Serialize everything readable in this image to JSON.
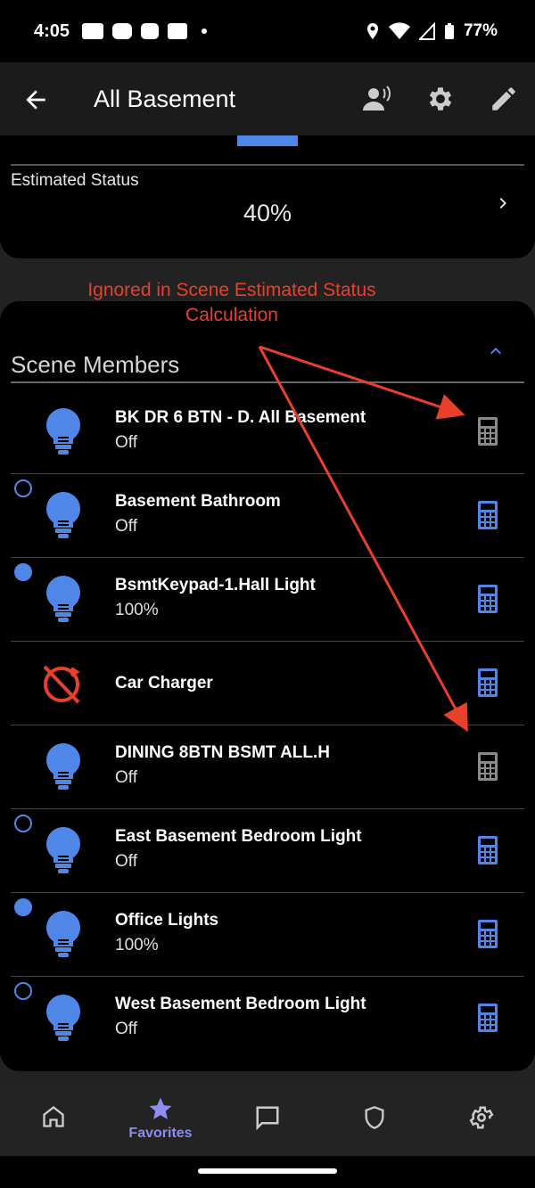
{
  "status_bar": {
    "time": "4:05",
    "battery": "77%"
  },
  "app_bar": {
    "title": "All Basement"
  },
  "estimated": {
    "label": "Estimated Status",
    "value": "40%"
  },
  "annotation": {
    "line1": "Ignored in Scene Estimated Status",
    "line2": "Calculation"
  },
  "members": {
    "title": "Scene Members",
    "rows": [
      {
        "name": "BK DR 6 BTN - D. All Basement",
        "state": "Off",
        "radio": "none",
        "icon": "bulb-icon",
        "calc_active": false
      },
      {
        "name": "Basement Bathroom",
        "state": "Off",
        "radio": "empty",
        "icon": "bulb-icon",
        "calc_active": true
      },
      {
        "name": "BsmtKeypad-1.Hall Light",
        "state": "100%",
        "radio": "filled",
        "icon": "bulb-icon",
        "calc_active": true
      },
      {
        "name": "Car Charger",
        "state": "",
        "radio": "none",
        "icon": "car-charger-offline-icon",
        "calc_active": true
      },
      {
        "name": "DINING 8BTN BSMT ALL.H",
        "state": "Off",
        "radio": "none",
        "icon": "bulb-icon",
        "calc_active": false
      },
      {
        "name": "East Basement Bedroom Light",
        "state": "Off",
        "radio": "empty",
        "icon": "bulb-icon",
        "calc_active": true
      },
      {
        "name": "Office Lights",
        "state": "100%",
        "radio": "filled",
        "icon": "bulb-icon",
        "calc_active": true
      },
      {
        "name": "West Basement Bedroom Light",
        "state": "Off",
        "radio": "empty",
        "icon": "bulb-icon",
        "calc_active": true
      }
    ]
  },
  "bottom_nav": {
    "items": [
      {
        "label": "",
        "icon": "home-icon"
      },
      {
        "label": "Favorites",
        "icon": "star-icon",
        "active": true
      },
      {
        "label": "",
        "icon": "chat-icon"
      },
      {
        "label": "",
        "icon": "shield-icon"
      },
      {
        "label": "",
        "icon": "gear-icon"
      }
    ]
  },
  "colors": {
    "accent": "#4f86e8",
    "nav_active": "#8b8df0",
    "annotation": "#e8402b",
    "warning_icon": "#e8402b",
    "inactive_calc": "#8a8a8a"
  }
}
